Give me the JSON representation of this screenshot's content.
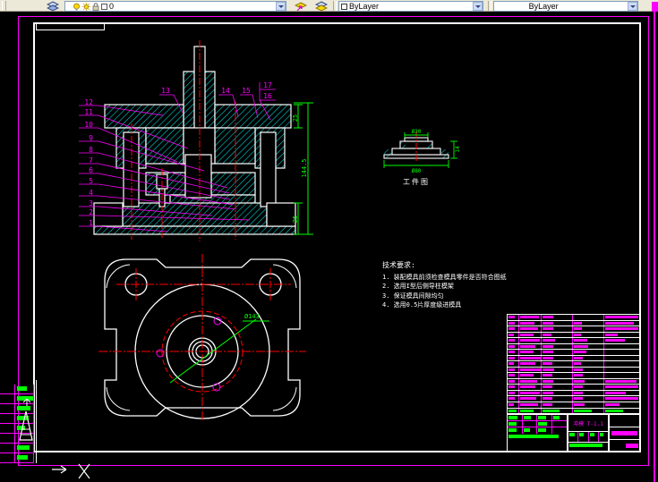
{
  "toolbar": {
    "layer_combo": {
      "value": "0"
    },
    "color_combo": {
      "value": "ByLayer"
    },
    "linetype_combo": {
      "value": "ByLayer"
    }
  },
  "section_view": {
    "left_labels": [
      "12",
      "11",
      "10",
      "9",
      "8",
      "7",
      "6",
      "5",
      "4",
      "3",
      "2",
      "1"
    ],
    "top_labels": [
      "13",
      "14",
      "15",
      "16",
      "17"
    ],
    "dims": {
      "plate_top": "25",
      "overall": "144.5",
      "plate_bottom": "25"
    }
  },
  "plan_view": {
    "dim_label": "Ø143"
  },
  "workpiece_view": {
    "caption": "工件图",
    "dim_top": "Ø30",
    "dim_bottom": "Ø80",
    "dim_right": "14"
  },
  "notes": {
    "title": "技术要求:",
    "items": [
      "1. 装配模具前须检查模具零件是否符合图纸",
      "2. 选用I型后侧导柱模架",
      "3. 保证模具间隙均匀",
      "4. 选用0.5片厚度级进模具"
    ]
  },
  "title_block": {
    "drawing_code": "冲模 T-1.1",
    "bom_rows": [
      [
        "55%",
        "85%",
        "35%",
        "0%",
        "92%",
        "#ff00ff"
      ],
      [
        "55%",
        "65%",
        "35%",
        "28%",
        "80%",
        "#ff00ff"
      ],
      [
        "55%",
        "80%",
        "35%",
        "28%",
        "92%",
        "#ff00ff"
      ],
      [
        "50%",
        "60%",
        "30%",
        "25%",
        "35%",
        "#ff00ff"
      ],
      [
        "55%",
        "88%",
        "40%",
        "45%",
        "55%",
        "#ff00ff"
      ],
      [
        "55%",
        "70%",
        "35%",
        "48%",
        "0%",
        "#ff00ff"
      ],
      [
        "55%",
        "60%",
        "35%",
        "42%",
        "0%",
        "#ff00ff"
      ],
      [
        "55%",
        "92%",
        "35%",
        "30%",
        "0%",
        "#ff00ff"
      ],
      [
        "50%",
        "68%",
        "32%",
        "26%",
        "0%",
        "#ff00ff"
      ],
      [
        "55%",
        "92%",
        "38%",
        "30%",
        "0%",
        "#ff00ff"
      ],
      [
        "55%",
        "62%",
        "32%",
        "30%",
        "0%",
        "#ff00ff"
      ],
      [
        "55%",
        "78%",
        "35%",
        "36%",
        "88%",
        "#ff00ff"
      ],
      [
        "55%",
        "68%",
        "32%",
        "30%",
        "92%",
        "#ff00ff"
      ],
      [
        "55%",
        "88%",
        "35%",
        "30%",
        "58%",
        "#ff00ff"
      ],
      [
        "55%",
        "72%",
        "32%",
        "30%",
        "92%",
        "#ff00ff"
      ],
      [
        "50%",
        "82%",
        "32%",
        "36%",
        "40%",
        "#ff00ff"
      ],
      [
        "70%",
        "60%",
        "55%",
        "60%",
        "50%",
        "#00ff00"
      ]
    ],
    "sig_rows": [
      [
        "65%",
        "55%",
        "60%",
        "45%"
      ],
      [
        "60%",
        "0%",
        "65%",
        "0%"
      ],
      [
        "55%",
        "50%",
        "60%",
        "0%"
      ]
    ],
    "sig_bottom": "85%",
    "mid_cells": [
      "60%",
      "50%",
      "55%",
      "45%"
    ],
    "right_mid_blob": "85%",
    "right_bottom_blob": "40%"
  },
  "left_table": {
    "rows": [
      "55%",
      "90%",
      "75%",
      "65%",
      "45%",
      "0%",
      "70%",
      "60%"
    ]
  },
  "colors": {
    "outline": "#ffffff",
    "hatch": "#00e0e0",
    "centerline": "#ff0000",
    "dimension": "#00ff00",
    "annotation": "#ff00ff",
    "toolbar_bg": "#ece9d8"
  }
}
